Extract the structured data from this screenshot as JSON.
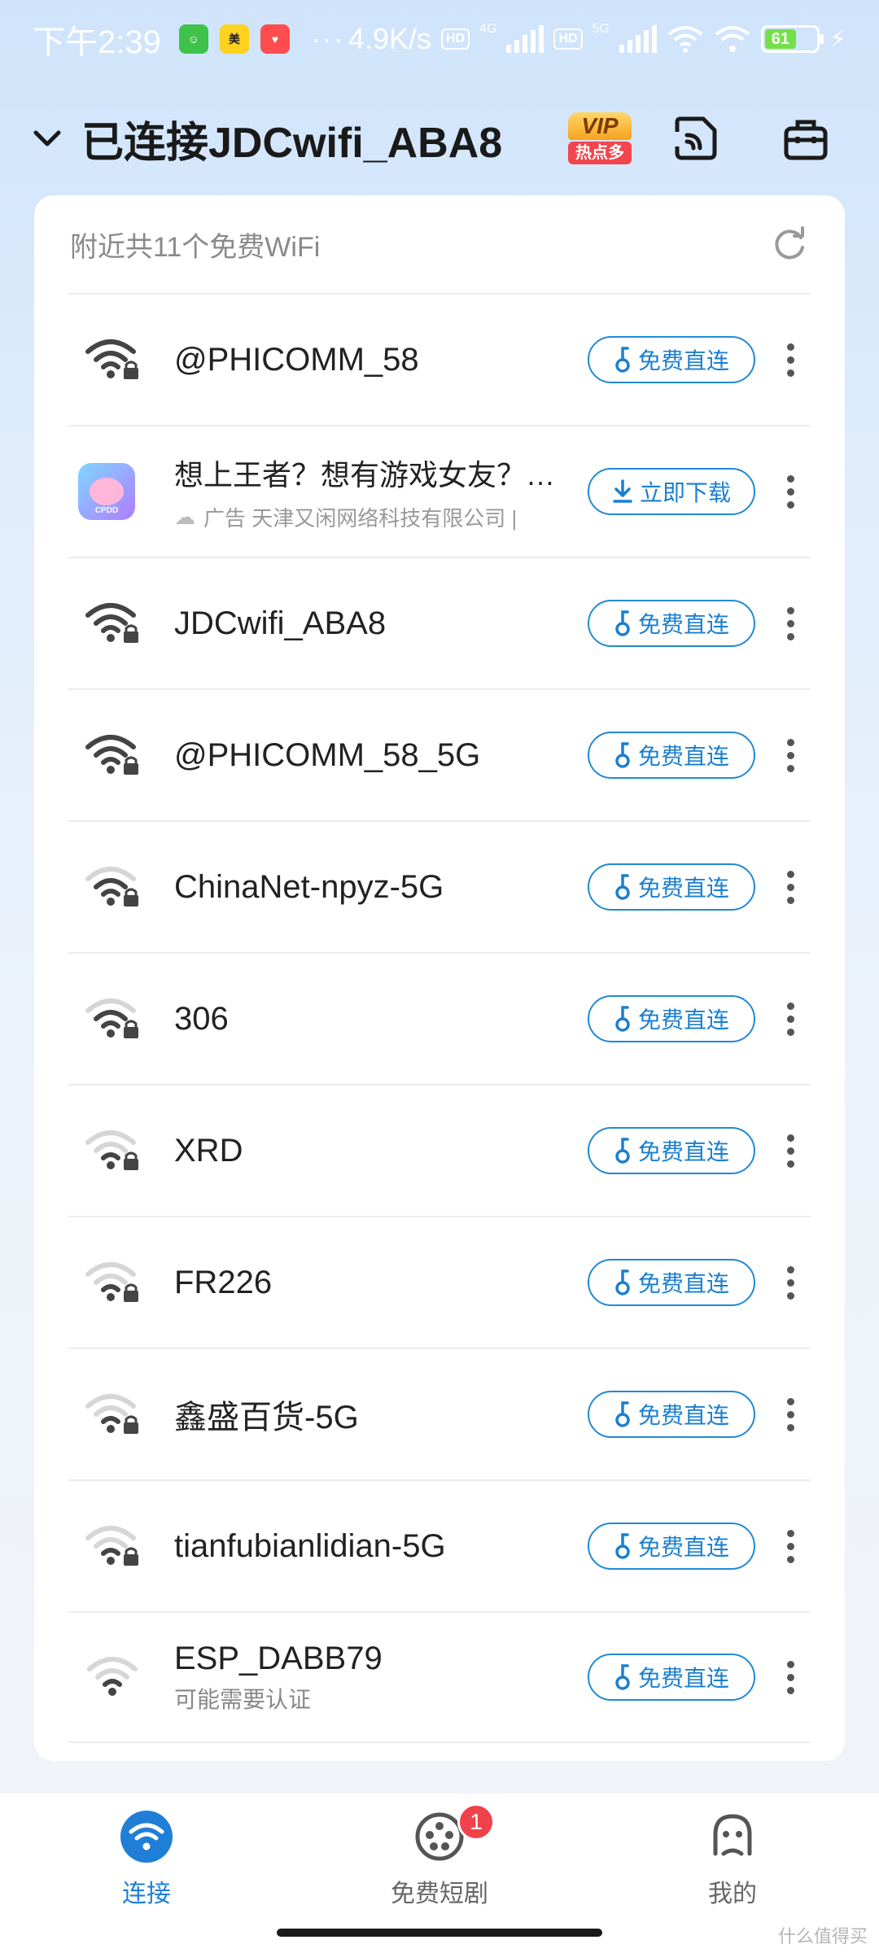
{
  "status_bar": {
    "time": "下午2:39",
    "dots": "···",
    "net_speed": "4.9K/s",
    "hd": "HD",
    "net_4g": "4G",
    "net_5g": "5G",
    "battery": "61"
  },
  "header": {
    "title": "已连接JDCwifi_ABA8",
    "vip_top": "VIP",
    "vip_bottom": "热点多"
  },
  "card": {
    "count_text": "附近共11个免费WiFi"
  },
  "buttons": {
    "connect": "免费直连",
    "download": "立即下载"
  },
  "ad": {
    "title": "想上王者？想有游戏女友？一键下载",
    "meta": "广告  天津又闲网络科技有限公司  |"
  },
  "networks": [
    {
      "ssid": "@PHICOMM_58",
      "subtitle": "",
      "signal": 4
    },
    {
      "ssid": "JDCwifi_ABA8",
      "subtitle": "",
      "signal": 4
    },
    {
      "ssid": "@PHICOMM_58_5G",
      "subtitle": "",
      "signal": 4
    },
    {
      "ssid": "ChinaNet-npyz-5G",
      "subtitle": "",
      "signal": 3
    },
    {
      "ssid": "306",
      "subtitle": "",
      "signal": 3
    },
    {
      "ssid": "XRD",
      "subtitle": "",
      "signal": 2
    },
    {
      "ssid": "FR226",
      "subtitle": "",
      "signal": 2
    },
    {
      "ssid": "鑫盛百货-5G",
      "subtitle": "",
      "signal": 2
    },
    {
      "ssid": "tianfubianlidian-5G",
      "subtitle": "",
      "signal": 2
    },
    {
      "ssid": "ESP_DABB79",
      "subtitle": "可能需要认证",
      "signal": 2
    }
  ],
  "bottom_nav": {
    "items": [
      {
        "label": "连接",
        "icon": "wifi-icon"
      },
      {
        "label": "免费短剧",
        "icon": "film-reel-icon"
      },
      {
        "label": "我的",
        "icon": "profile-icon"
      }
    ],
    "badge": "1"
  },
  "watermark": "什么值得买",
  "colors": {
    "accent": "#1f7fd6",
    "badge_red": "#f0424a"
  }
}
